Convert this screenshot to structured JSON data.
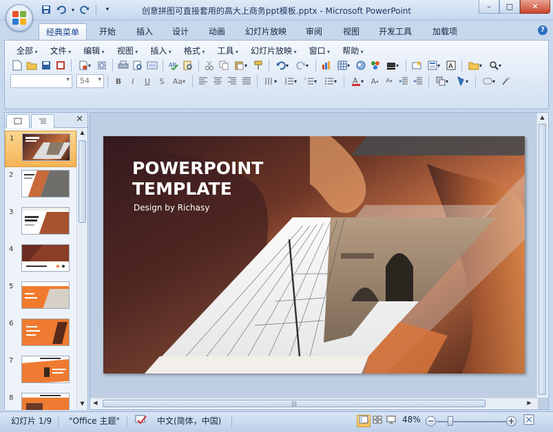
{
  "window": {
    "title": "创意拼图可直接套用的高大上商务ppt模板.pptx - Microsoft PowerPoint",
    "minimize": "–",
    "maximize": "□",
    "close": "✕"
  },
  "ribbon_tabs": [
    "经典菜单",
    "开始",
    "插入",
    "设计",
    "动画",
    "幻灯片放映",
    "审阅",
    "视图",
    "开发工具",
    "加载项"
  ],
  "active_tab": "经典菜单",
  "menubar": [
    "全部",
    "文件",
    "编辑",
    "视图",
    "插入",
    "格式",
    "工具",
    "幻灯片放映",
    "窗口",
    "帮助"
  ],
  "font_size_combo": "54",
  "font_name_combo": "",
  "slide_pane": {
    "close": "✕",
    "thumbnails": [
      {
        "num": "1",
        "selected": true
      },
      {
        "num": "2",
        "selected": false
      },
      {
        "num": "3",
        "selected": false
      },
      {
        "num": "4",
        "selected": false
      },
      {
        "num": "5",
        "selected": false
      },
      {
        "num": "6",
        "selected": false
      },
      {
        "num": "7",
        "selected": false
      },
      {
        "num": "8",
        "selected": false
      }
    ]
  },
  "slide": {
    "title_line1": "POWERPOINT",
    "title_line2": "TEMPLATE",
    "subtitle": "Design by Richasy"
  },
  "statusbar": {
    "slide_info": "幻灯片 1/9",
    "theme": "\"Office 主题\"",
    "language": "中文(简体，中国)",
    "zoom": "48%"
  },
  "colors": {
    "accent_orange": "#f07a2e",
    "selected_thumb": "#f6b355",
    "ribbon_blue": "#dfe9f6"
  }
}
